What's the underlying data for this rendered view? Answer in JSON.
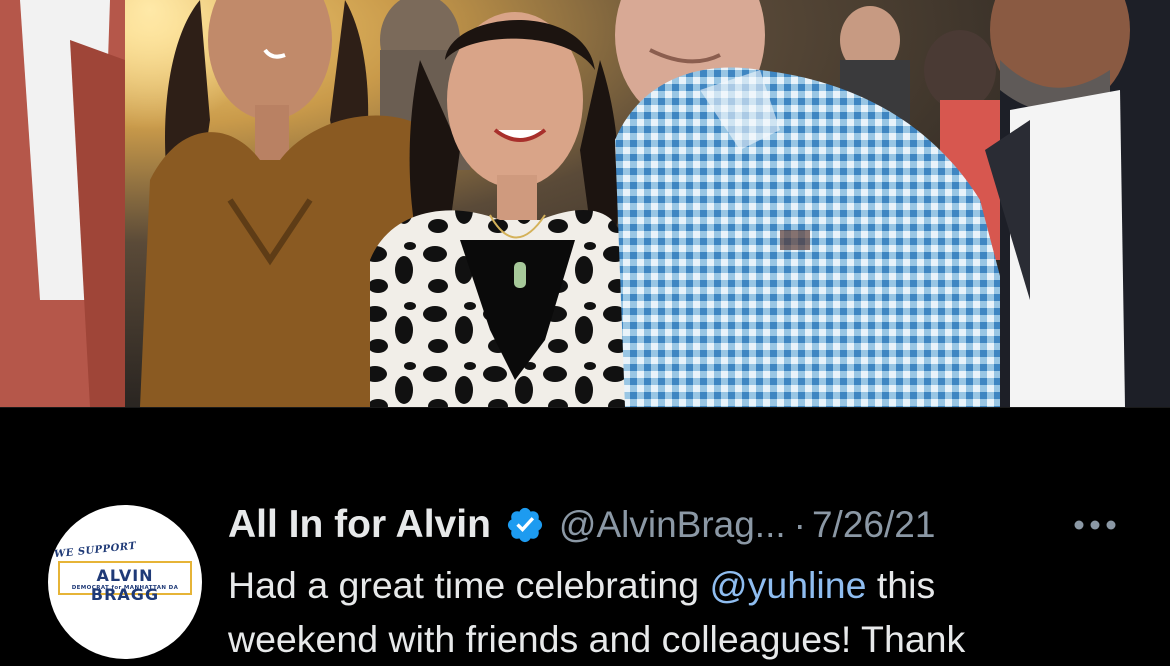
{
  "photo": {
    "alt_icon": "group-photo"
  },
  "tweet": {
    "display_name": "All In for Alvin",
    "verified_icon": "verified-badge-icon",
    "handle": "@AlvinBrag...",
    "separator": "·",
    "timestamp": "7/26/21",
    "more_icon": "more-options-icon",
    "text_line1_pre": "Had a great time celebrating ",
    "mention": "@yuhline",
    "text_line1_post": " this",
    "text_line2": "weekend with friends and colleagues! Thank"
  },
  "avatar": {
    "we_support": "WE SUPPORT",
    "name": "ALVIN BRAGG",
    "subtitle": "DEMOCRAT for MANHATTAN DA"
  },
  "colors": {
    "background": "#000000",
    "primary_text": "#e7e9ea",
    "secondary_text": "#8b98a5",
    "mention": "#8fbdf0",
    "verified": "#1d9bf0",
    "logo_blue": "#1f3a77",
    "logo_gold": "#e6b437"
  }
}
